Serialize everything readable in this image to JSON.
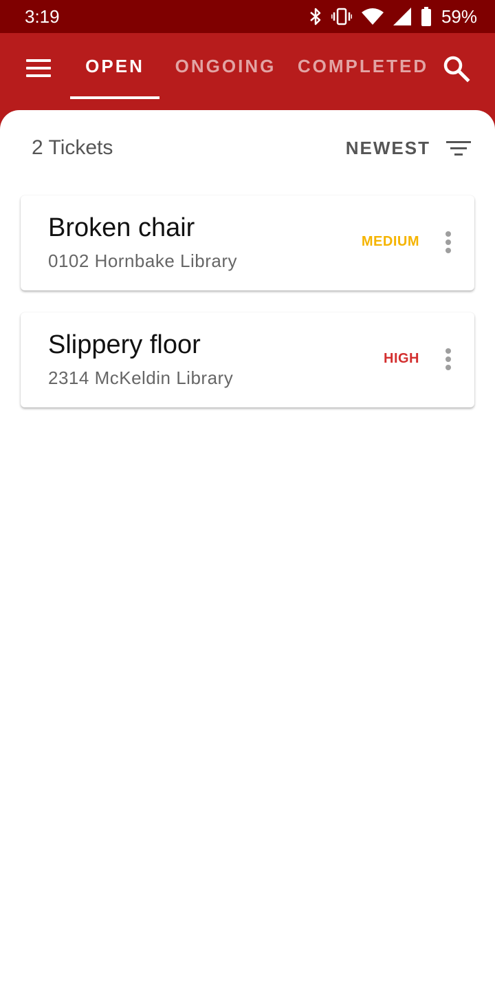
{
  "status_bar": {
    "time": "3:19",
    "battery": "59%",
    "icons": [
      "bluetooth-icon",
      "vibrate-icon",
      "wifi-icon",
      "cell-signal-icon",
      "battery-icon"
    ]
  },
  "app_bar": {
    "menu_icon": "menu-icon",
    "search_icon": "search-icon",
    "tabs": [
      {
        "label": "OPEN",
        "active": true
      },
      {
        "label": "ONGOING",
        "active": false
      },
      {
        "label": "COMPLETED",
        "active": false
      }
    ]
  },
  "list_header": {
    "count_text": "2 Tickets",
    "sort_label": "NEWEST",
    "filter_icon": "filter-icon"
  },
  "tickets": [
    {
      "title": "Broken chair",
      "location": "0102 Hornbake Library",
      "priority": "MEDIUM",
      "priority_color": "#f5b400"
    },
    {
      "title": "Slippery floor",
      "location": "2314 McKeldin Library",
      "priority": "HIGH",
      "priority_color": "#d32f2f"
    }
  ],
  "colors": {
    "status_bar": "#7f0000",
    "primary": "#b71c1c",
    "tab_inactive": "rgba(255,255,255,0.6)"
  }
}
